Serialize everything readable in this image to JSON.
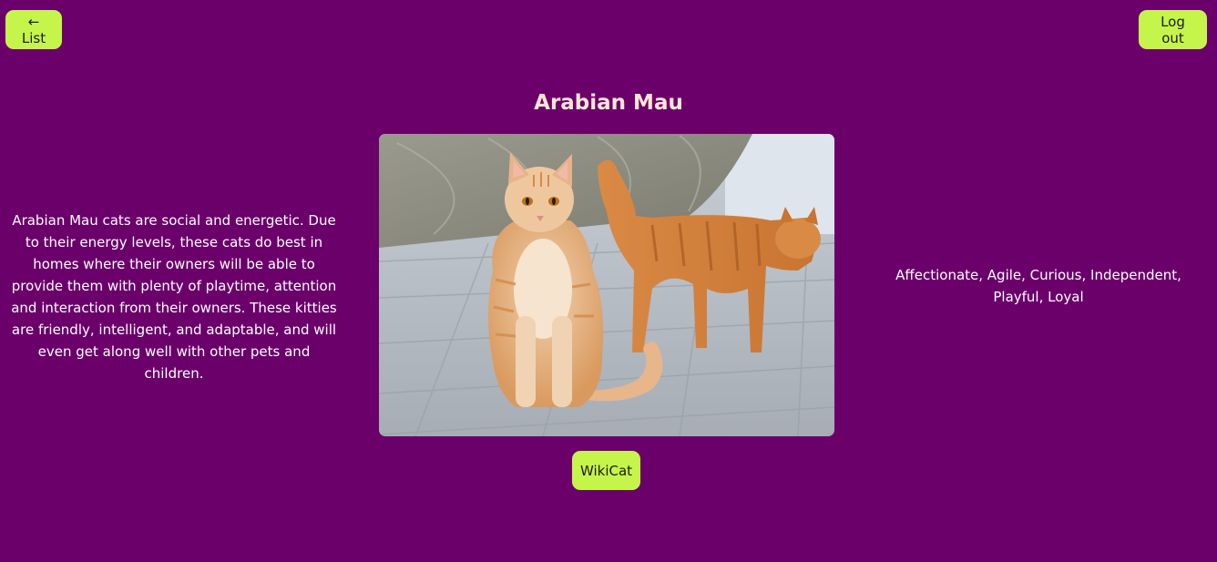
{
  "nav": {
    "back_label": "← List",
    "logout_label": "Log out"
  },
  "breed": {
    "name": "Arabian Mau",
    "description": "Arabian Mau cats are social and energetic. Due to their energy levels, these cats do best in homes where their owners will be able to provide them with plenty of playtime, attention and interaction from their owners. These kitties are friendly, intelligent, and adaptable, and will even get along well with other pets and children.",
    "temperament": "Affectionate, Agile, Curious, Independent, Playful, Loyal",
    "wiki_label": "WikiCat"
  },
  "colors": {
    "background": "#6b006b",
    "button": "#c5f54a",
    "title": "#fde7d2"
  }
}
